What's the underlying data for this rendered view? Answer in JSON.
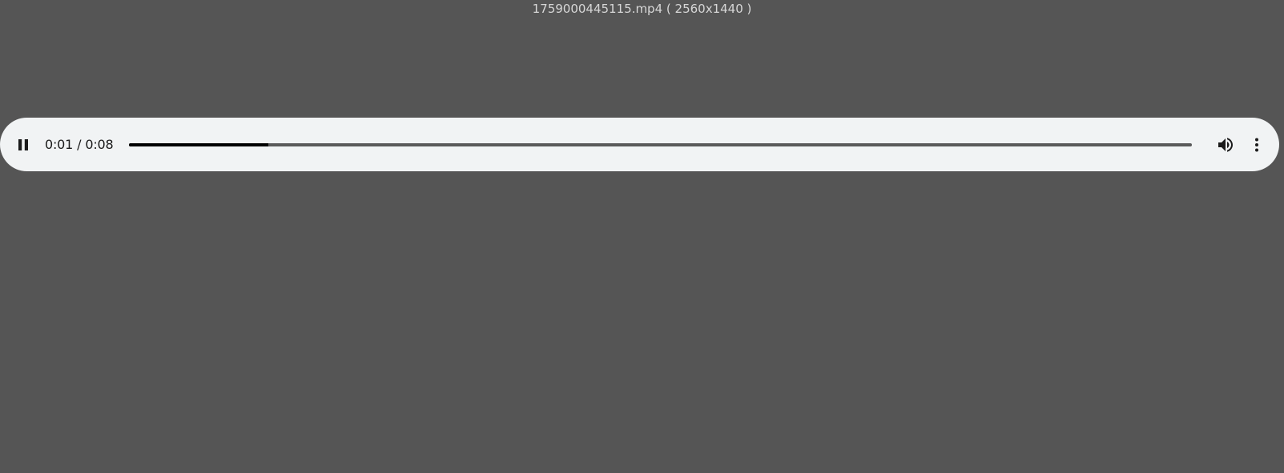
{
  "window": {
    "file_name": "1759000445115.mp4",
    "resolution": "( 2560x1440 )"
  },
  "player": {
    "state": "playing",
    "current_time": "0:01",
    "separator": "/",
    "duration": "0:08",
    "progress_fraction": 0.131,
    "icons": {
      "play_pause": "pause-icon",
      "volume": "volume-icon",
      "menu": "more-vert-icon"
    },
    "colors": {
      "page_background": "#555555",
      "bar_background": "#f1f3f4",
      "progress_played": "#000000",
      "progress_remaining": "#5a5a5a"
    }
  }
}
